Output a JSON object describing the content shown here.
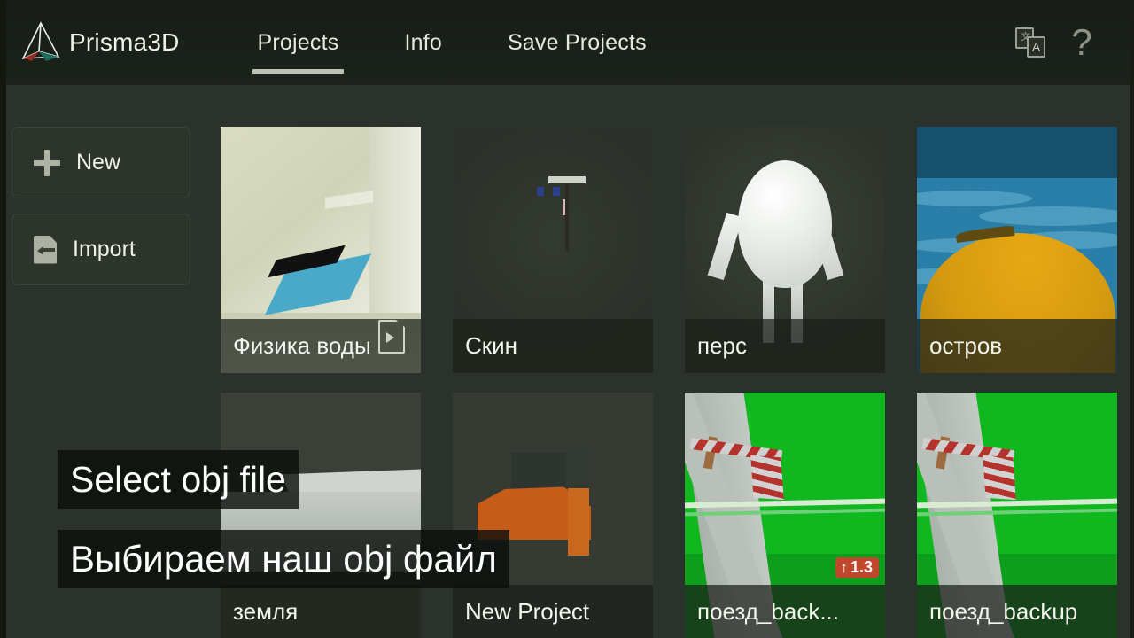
{
  "app": {
    "brand": "Prisma3D",
    "logo_icon": "prism-wireframe-logo",
    "accent_underline_color": "#bcc2b4",
    "header_bg": "#1a211a",
    "body_bg": "#2b322b"
  },
  "header": {
    "tabs": [
      {
        "label": "Projects",
        "active": true
      },
      {
        "label": "Info",
        "active": false
      },
      {
        "label": "Save Projects",
        "active": false
      }
    ],
    "right_icons": [
      {
        "name": "translate-icon",
        "glyph_primary": "文",
        "glyph_secondary": "A"
      },
      {
        "name": "help-icon",
        "glyph": "?"
      }
    ]
  },
  "side_actions": [
    {
      "label": "New",
      "icon": "plus-icon"
    },
    {
      "label": "Import",
      "icon": "file-import-icon"
    }
  ],
  "projects": {
    "row1": [
      {
        "label": "Физика воды",
        "scene": "water-physics",
        "has_file_icon": true,
        "badge": null
      },
      {
        "label": "Скин",
        "scene": "minecraft-skin",
        "has_file_icon": false,
        "badge": null
      },
      {
        "label": "перс",
        "scene": "egg-character",
        "has_file_icon": false,
        "badge": null
      },
      {
        "label": "остров",
        "scene": "island",
        "has_file_icon": false,
        "badge": null
      }
    ],
    "row2": [
      {
        "label": "земля",
        "scene": "ground-block",
        "has_file_icon": false,
        "badge": null
      },
      {
        "label": "New Project",
        "scene": "orange-chair",
        "has_file_icon": false,
        "badge": null
      },
      {
        "label": "поезд_back...",
        "scene": "train-crossing",
        "has_file_icon": false,
        "badge": {
          "arrow": "↑",
          "value": "1.3",
          "color": "#c0462c"
        }
      },
      {
        "label": "поезд_backup",
        "scene": "train-crossing",
        "has_file_icon": false,
        "badge": null
      }
    ]
  },
  "overlay_captions": [
    {
      "text": "Select obj file"
    },
    {
      "text": "Выбираем наш obj файл"
    }
  ]
}
